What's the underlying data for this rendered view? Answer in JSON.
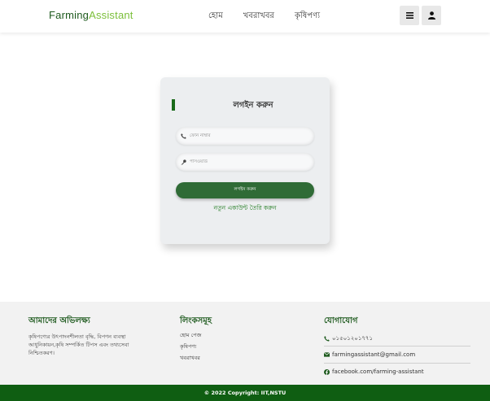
{
  "brand": {
    "part1": "Farming",
    "part2": "Assistant"
  },
  "nav": {
    "items": [
      "হোম",
      "খবরাখবর",
      "কৃষিপণ্য"
    ]
  },
  "icons": {
    "menu": "bars-icon",
    "user": "user-icon",
    "phone": "phone-icon",
    "key": "key-icon",
    "mail": "envelope-icon",
    "facebook": "facebook-icon"
  },
  "login": {
    "title": "লগইন করুন",
    "phone_placeholder": "ফোন নাম্বার",
    "password_placeholder": "পাসওয়ার্ড",
    "button": "লগইন করুন",
    "signup": "নতুন একাউন্ট তৈরি করুন"
  },
  "footer": {
    "about_title": "আমাদের অভিলক্ষ্য",
    "about_text": "কৃষিপণ্যের উৎপাদনশীলতা বৃদ্ধি, বিপণন ব্যবস্থা আধুনিকায়ন,কৃষি সম্পর্কিত টিপস এবং তথ্যসেবা নিশ্চিতকরণ।",
    "links_title": "লিংকসমূহ",
    "links": [
      "হোম পেজ",
      "কৃষিপণ্য",
      "খবরাখবর"
    ],
    "contact_title": "যোগাযোগ",
    "phone": "০১৫০১২০১৭৭১",
    "email": "farmingassistant@gmail.com",
    "facebook": "facebook.com/farming-assistant",
    "copyright": "© 2022 Copyright: IIT,NSTU"
  },
  "colors": {
    "brand_dark": "#1e5a1e",
    "brand_light": "#7bbf3a",
    "button": "#2f6b36",
    "footer_bar": "#0f5e12"
  }
}
